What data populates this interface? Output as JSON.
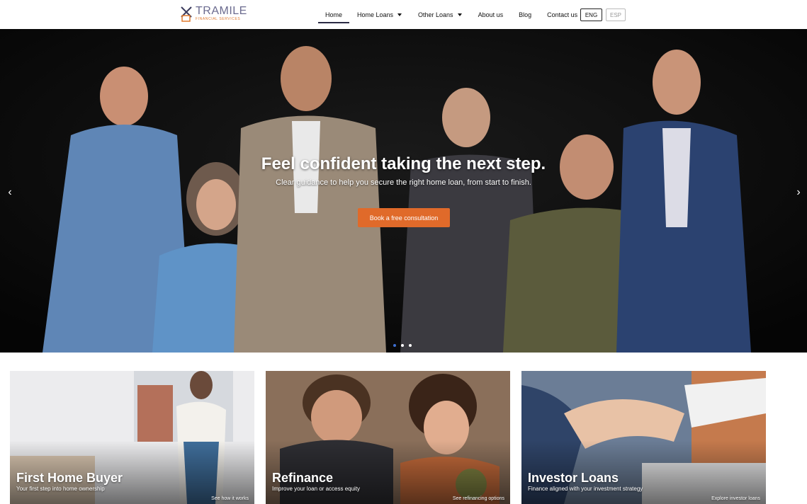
{
  "header": {
    "logo": {
      "word": "TRAMILE",
      "sub": "Financial Services"
    },
    "nav": [
      {
        "label": "Home",
        "active": true,
        "dropdown": false
      },
      {
        "label": "Home Loans",
        "active": false,
        "dropdown": true
      },
      {
        "label": "Other Loans",
        "active": false,
        "dropdown": true
      },
      {
        "label": "About us",
        "active": false,
        "dropdown": false
      },
      {
        "label": "Blog",
        "active": false,
        "dropdown": false
      },
      {
        "label": "Contact us",
        "active": false,
        "dropdown": false
      }
    ],
    "lang": {
      "eng": "ENG",
      "esp": "ESP"
    }
  },
  "hero": {
    "title": "Feel confident taking the next step.",
    "subtitle": "Clear guidance to help you secure the right home loan, from start to finish.",
    "cta": "Book a free consultation",
    "prev_icon": "‹",
    "next_icon": "›",
    "slides": 3,
    "active_slide": 1
  },
  "cards": [
    {
      "title": "First Home Buyer",
      "subtitle": "Your first step into home ownership",
      "link": "See how it works"
    },
    {
      "title": "Refinance",
      "subtitle": "Improve your loan or access equity",
      "link": "See refinancing options"
    },
    {
      "title": "Investor Loans",
      "subtitle": "Finance aligned with your investment strategy",
      "link": "Explore investor loans"
    }
  ],
  "colors": {
    "accent": "#e06a2a",
    "nav_underline": "#2b2b44",
    "dot_active": "#3d6fd1",
    "logo_text": "#6b6b8f",
    "logo_accent": "#e07a2e"
  }
}
